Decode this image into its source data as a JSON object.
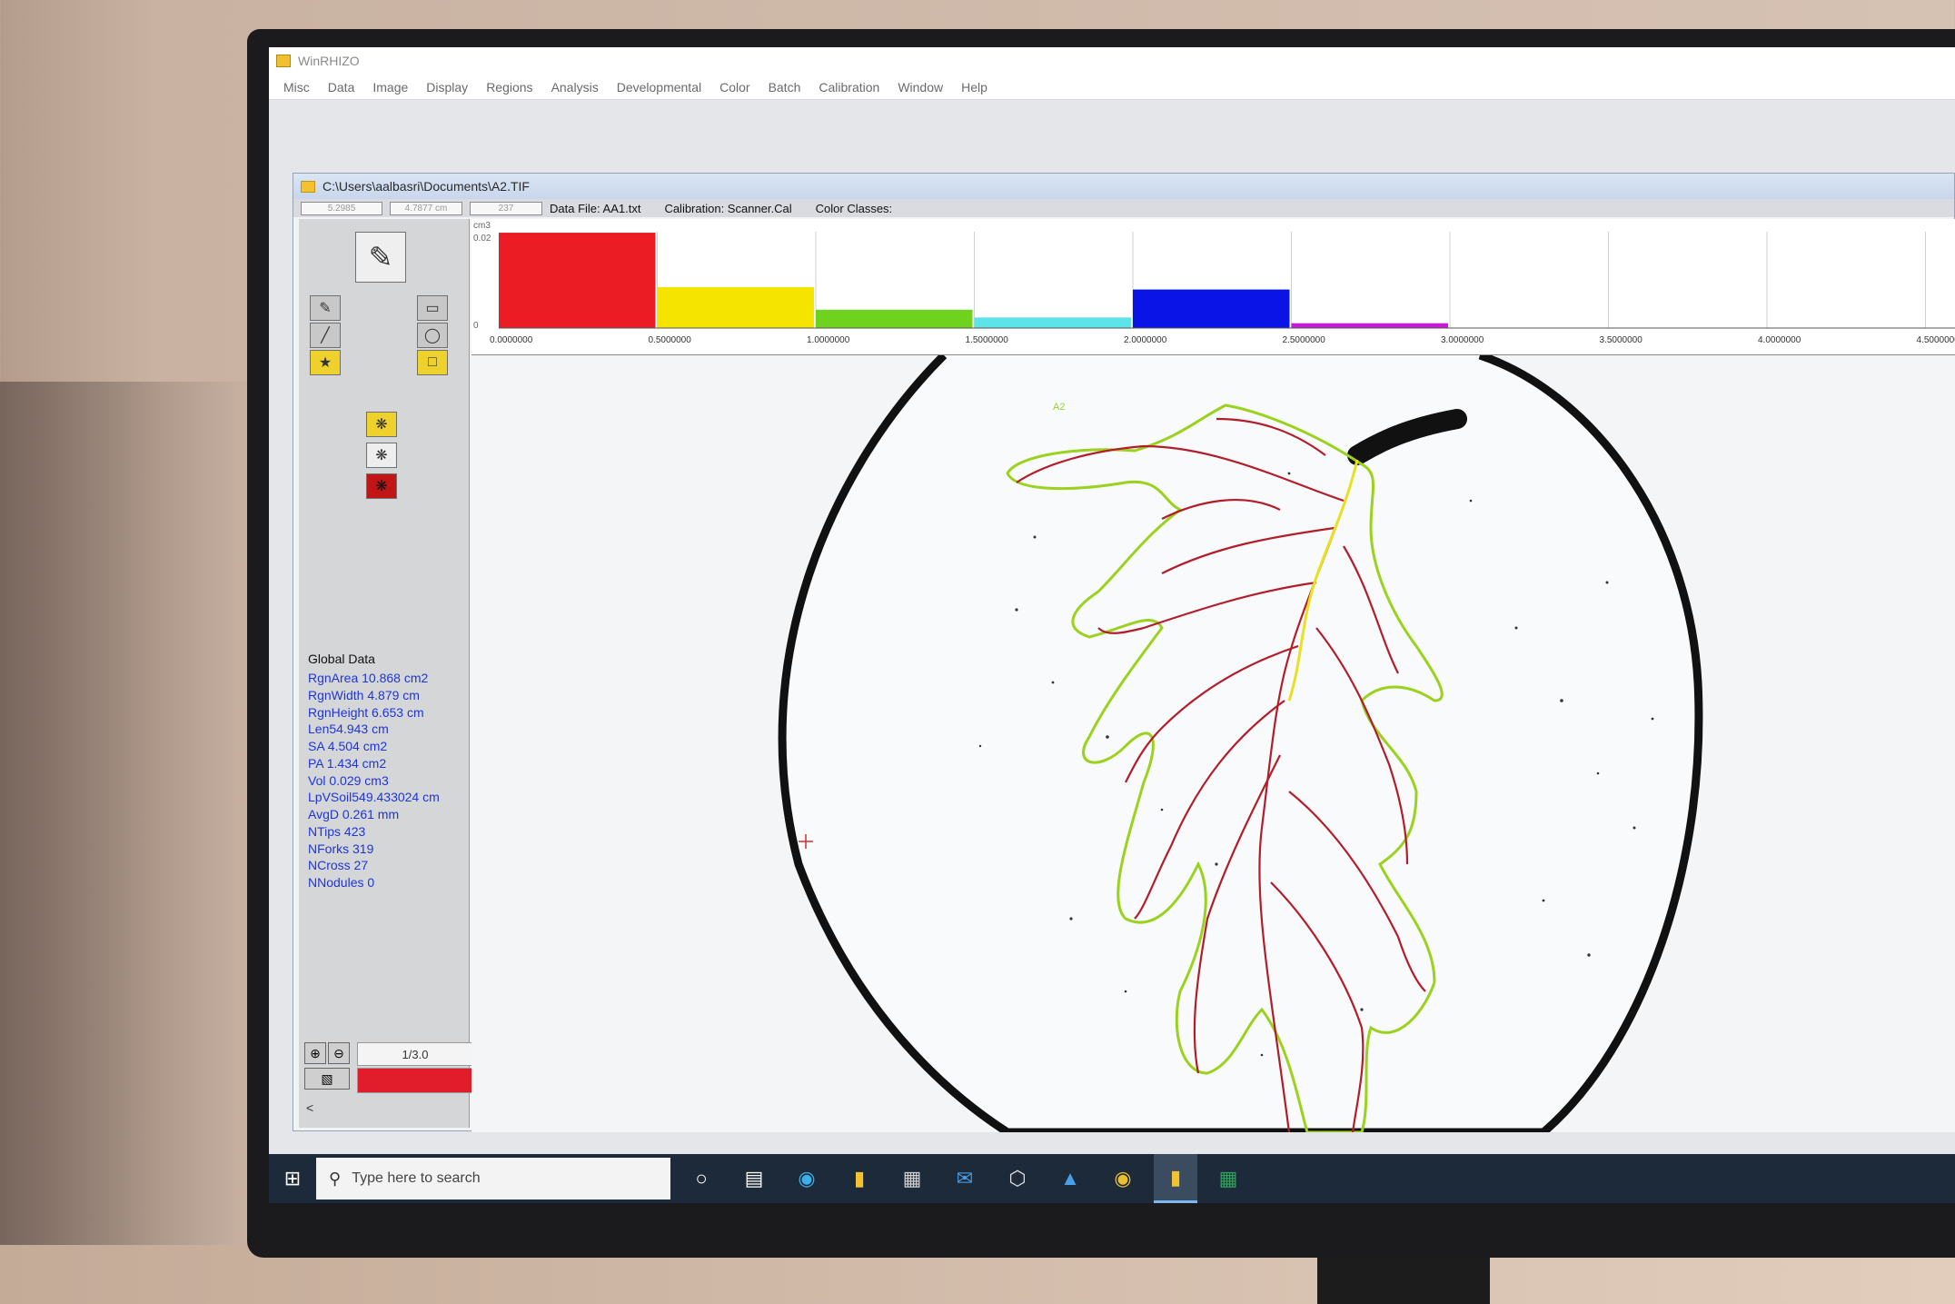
{
  "app": {
    "title": "WinRHIZO",
    "menu": [
      "Misc",
      "Data",
      "Image",
      "Display",
      "Regions",
      "Analysis",
      "Developmental",
      "Color",
      "Batch",
      "Calibration",
      "Window",
      "Help"
    ]
  },
  "child_window": {
    "path": "C:\\Users\\aalbasri\\Documents\\A2.TIF",
    "status": {
      "box1": "5.2985",
      "box2": "4.7877 cm",
      "box3": "237",
      "data_file": "Data File: AA1.txt",
      "calibration": "Calibration: Scanner.Cal",
      "color_classes": "Color Classes:"
    }
  },
  "global_data": {
    "title": "Global Data",
    "lines": [
      "RgnArea 10.868 cm2",
      "RgnWidth 4.879 cm",
      "RgnHeight 6.653 cm",
      "Len54.943 cm",
      "SA  4.504 cm2",
      "PA  1.434 cm2",
      "Vol  0.029 cm3",
      "LpVSoil549.433024 cm",
      "AvgD 0.261 mm",
      "NTips  423",
      "NForks   319",
      "NCross   27",
      "NNodules 0"
    ]
  },
  "zoom": {
    "label": "1/3.0",
    "back_arrow": "<"
  },
  "image": {
    "region_label": "A2"
  },
  "chart_data": {
    "type": "bar",
    "ylabel": "cm3",
    "yticks": [
      "0.02",
      "0"
    ],
    "ylim": [
      0,
      0.02
    ],
    "x_tick_labels": [
      "0.0000000",
      "0.5000000",
      "1.0000000",
      "1.5000000",
      "2.0000000",
      "2.5000000",
      "3.0000000",
      "3.5000000",
      "4.0000000",
      "4.5000000"
    ],
    "bins": [
      {
        "from": 0.0,
        "to": 0.5,
        "value": 0.0198,
        "color": "#ec1c24"
      },
      {
        "from": 0.5,
        "to": 1.0,
        "value": 0.0085,
        "color": "#f5e400"
      },
      {
        "from": 1.0,
        "to": 1.5,
        "value": 0.0038,
        "color": "#6fd21e"
      },
      {
        "from": 1.5,
        "to": 2.0,
        "value": 0.0022,
        "color": "#5ce4e8"
      },
      {
        "from": 2.0,
        "to": 2.5,
        "value": 0.008,
        "color": "#0a14e6"
      },
      {
        "from": 2.5,
        "to": 3.0,
        "value": 0.001,
        "color": "#c81ad6"
      },
      {
        "from": 3.0,
        "to": 3.5,
        "value": 0,
        "color": "#ffffff"
      },
      {
        "from": 3.5,
        "to": 4.0,
        "value": 0,
        "color": "#ffffff"
      },
      {
        "from": 4.0,
        "to": 4.5,
        "value": 0,
        "color": "#ffffff"
      },
      {
        "from": 4.5,
        "to": 5.0,
        "value": 0,
        "color": "#ffffff"
      }
    ]
  },
  "taskbar": {
    "search_placeholder": "Type here to search",
    "icons": [
      "cortana-icon",
      "task-view-icon",
      "edge-icon",
      "file-explorer-icon",
      "store-icon",
      "mail-icon",
      "3d-viewer-icon",
      "photos-icon",
      "chrome-icon",
      "winrhizo-icon",
      "excel-icon"
    ]
  }
}
